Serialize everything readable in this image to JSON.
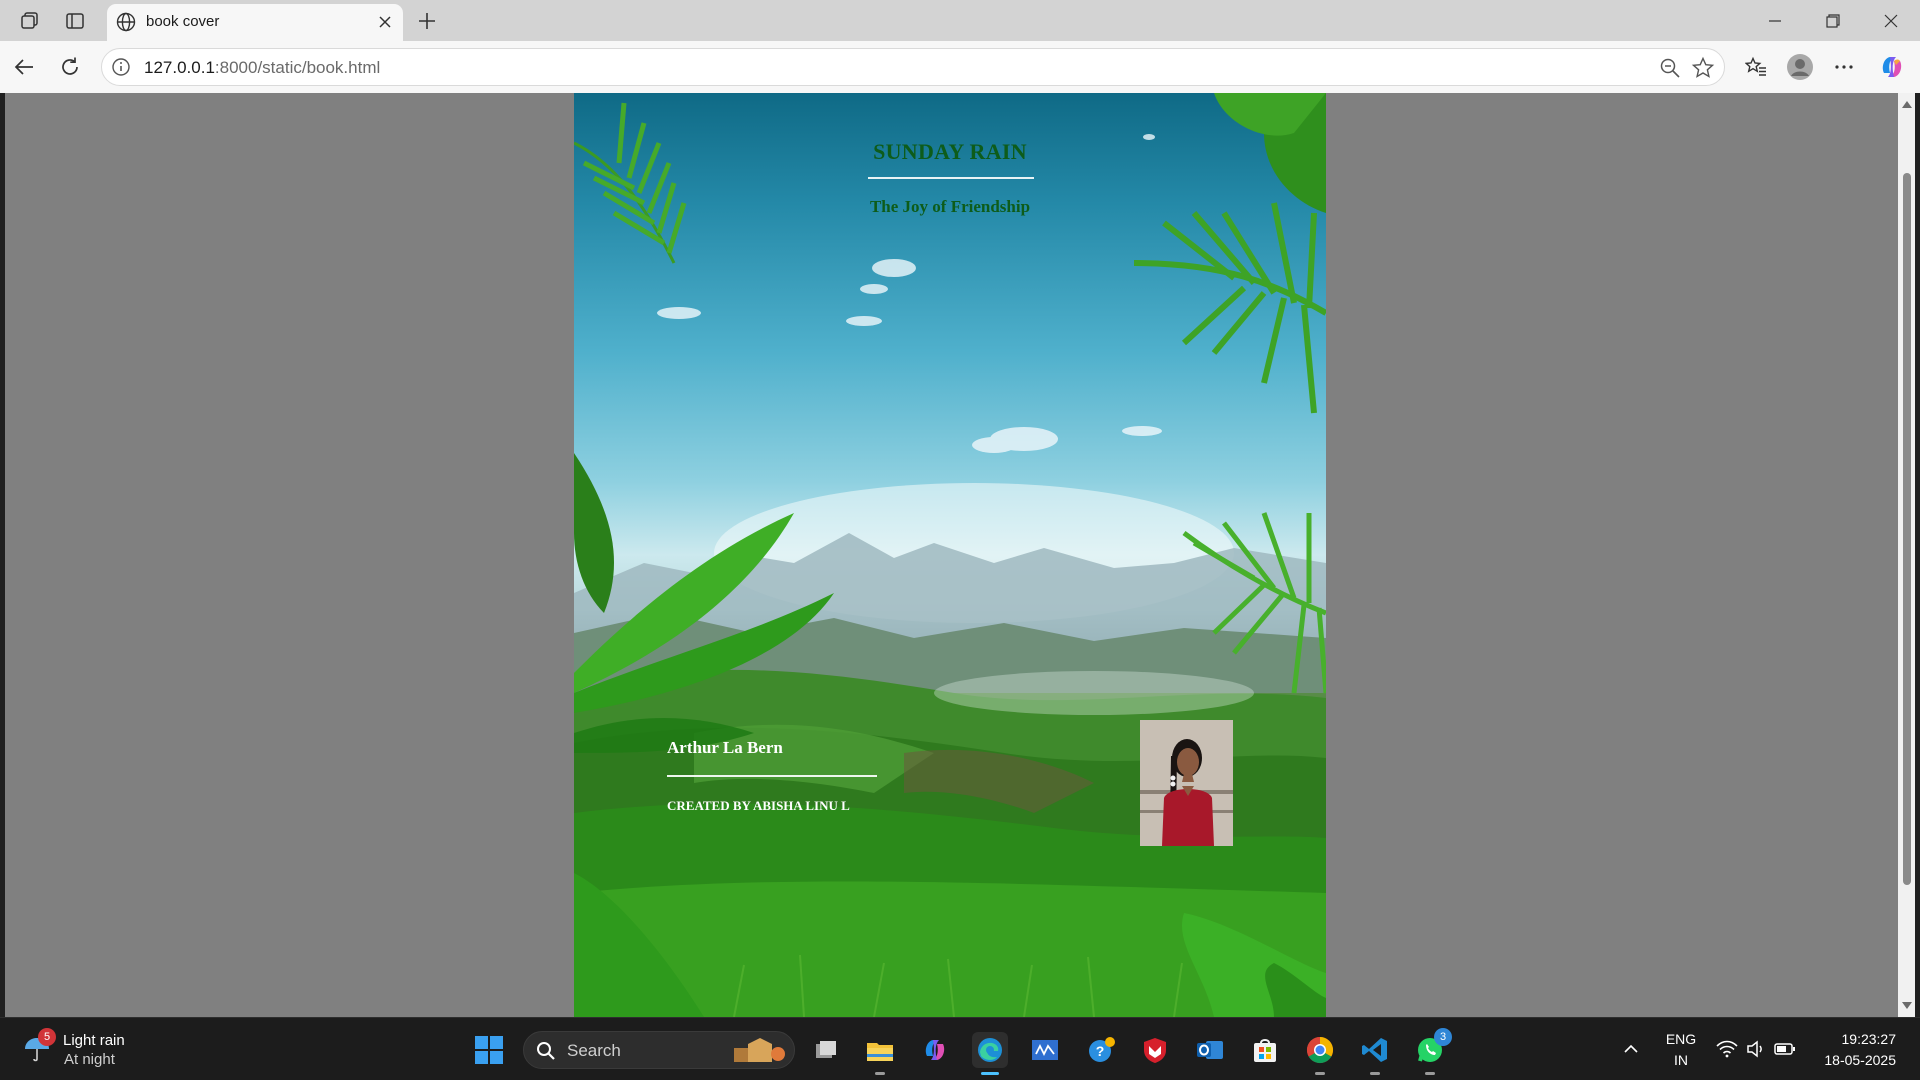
{
  "browser": {
    "tab_title": "book cover",
    "url_host": "127.0.0.1",
    "url_rest": ":8000/static/book.html"
  },
  "cover": {
    "title": "SUNDAY RAIN",
    "subtitle": "The Joy of Friendship",
    "author": "Arthur La Bern",
    "created_by": "CREATED BY ABISHA LINU L"
  },
  "taskbar": {
    "weather_badge": "5",
    "weather_condition": "Light rain",
    "weather_time": "At night",
    "search_placeholder": "Search",
    "whatsapp_badge": "3",
    "language": "ENG",
    "region": "IN",
    "time": "19:23:27",
    "date": "18-05-2025"
  }
}
